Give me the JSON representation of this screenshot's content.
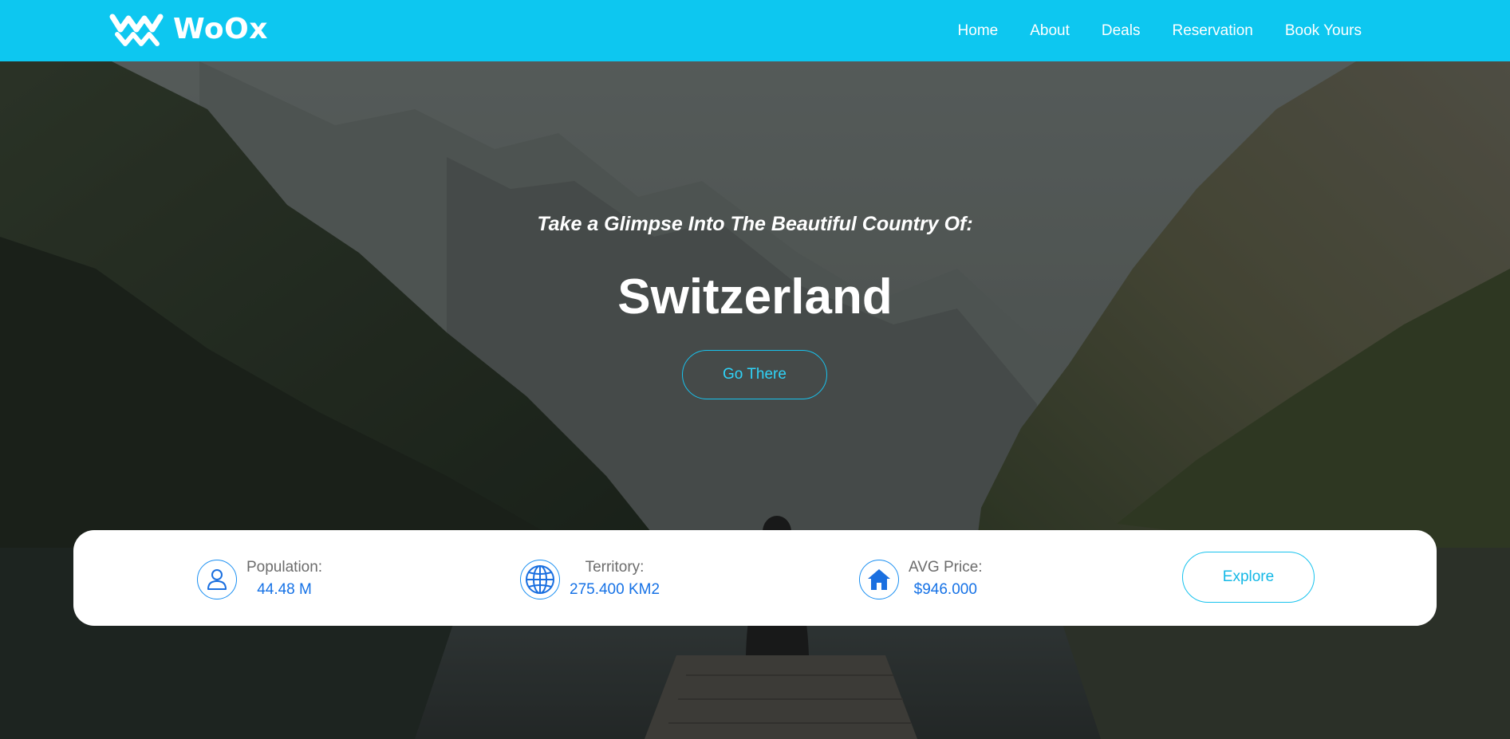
{
  "brand": {
    "name": "WoOx",
    "logo_icon": "woox-logo-icon"
  },
  "nav": {
    "items": [
      {
        "label": "Home"
      },
      {
        "label": "About"
      },
      {
        "label": "Deals"
      },
      {
        "label": "Reservation"
      },
      {
        "label": "Book Yours"
      }
    ]
  },
  "hero": {
    "subtitle": "Take a Glimpse Into The Beautiful Country Of:",
    "title": "Switzerland",
    "cta_label": "Go There"
  },
  "stats": [
    {
      "icon": "user-icon",
      "label": "Population:",
      "value": "44.48 M"
    },
    {
      "icon": "globe-icon",
      "label": "Territory:",
      "value": "275.400 KM2"
    },
    {
      "icon": "home-icon",
      "label": "AVG Price:",
      "value": "$946.000"
    }
  ],
  "explore_label": "Explore",
  "colors": {
    "header_bg": "#0dc7f0",
    "accent_cyan": "#18c3ee",
    "value_blue": "#1672e6",
    "label_gray": "#6c6c6c"
  }
}
